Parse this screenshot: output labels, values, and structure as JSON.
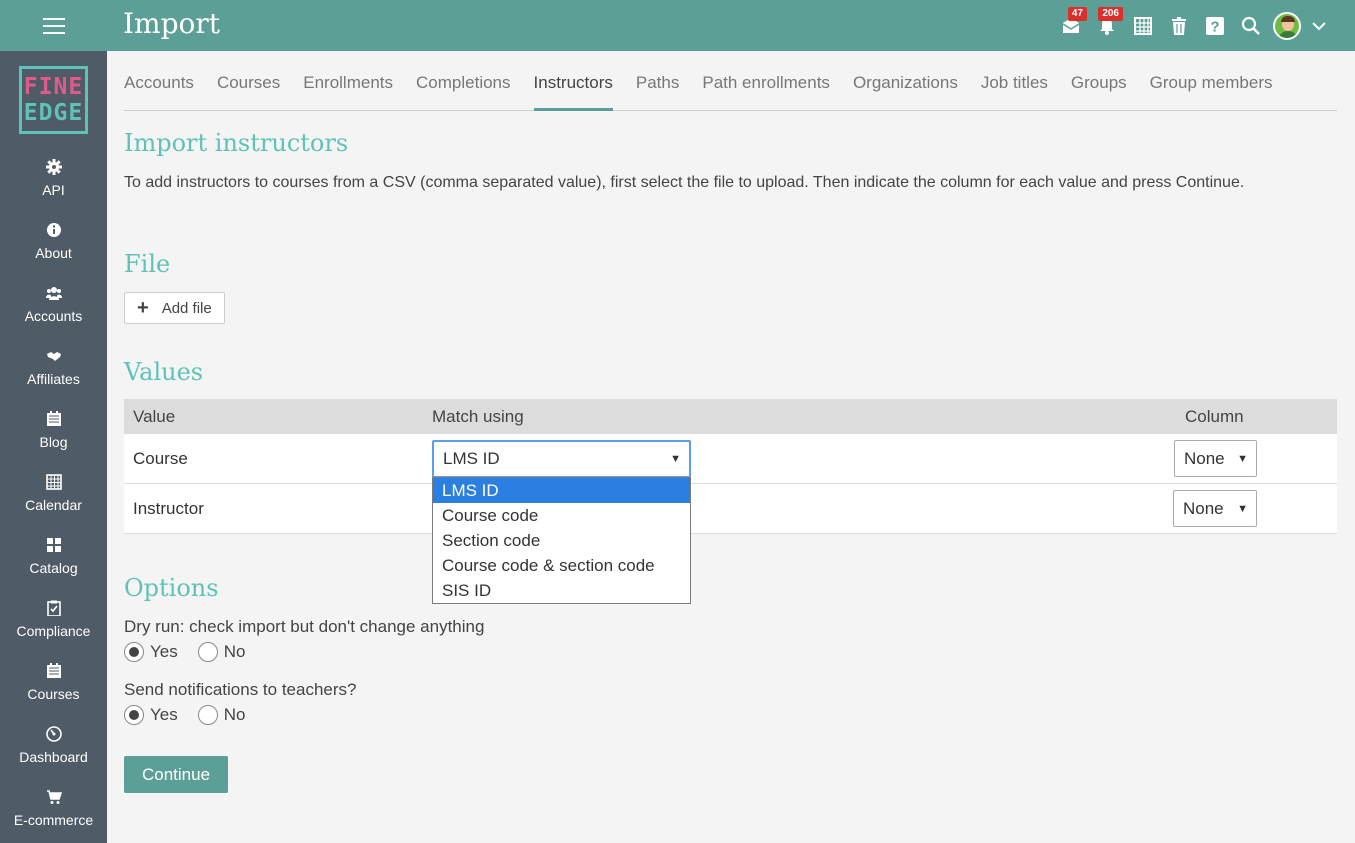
{
  "header": {
    "title": "Import",
    "messages_badge": "47",
    "notifications_badge": "206"
  },
  "sidebar": {
    "logo_line1": "FINE",
    "logo_line2": "EDGE",
    "items": [
      {
        "label": "API",
        "icon": "gear-icon"
      },
      {
        "label": "About",
        "icon": "info-icon"
      },
      {
        "label": "Accounts",
        "icon": "users-icon"
      },
      {
        "label": "Affiliates",
        "icon": "handshake-icon"
      },
      {
        "label": "Blog",
        "icon": "blog-icon"
      },
      {
        "label": "Calendar",
        "icon": "calendar-icon"
      },
      {
        "label": "Catalog",
        "icon": "catalog-icon"
      },
      {
        "label": "Compliance",
        "icon": "clipboard-check-icon"
      },
      {
        "label": "Courses",
        "icon": "courses-icon"
      },
      {
        "label": "Dashboard",
        "icon": "dashboard-icon"
      },
      {
        "label": "E-commerce",
        "icon": "cart-icon"
      }
    ]
  },
  "tabs": [
    "Accounts",
    "Courses",
    "Enrollments",
    "Completions",
    "Instructors",
    "Paths",
    "Path enrollments",
    "Organizations",
    "Job titles",
    "Groups",
    "Group members"
  ],
  "active_tab": "Instructors",
  "main": {
    "heading": "Import instructors",
    "description": "To add instructors to courses from a CSV (comma separated value), first select the file to upload. Then indicate the column for each value and press Continue.",
    "file_heading": "File",
    "add_file_label": "Add file",
    "values_heading": "Values",
    "table": {
      "headers": [
        "Value",
        "Match using",
        "Column"
      ],
      "rows": [
        {
          "value": "Course",
          "match": "LMS ID",
          "column": "None"
        },
        {
          "value": "Instructor",
          "match": "",
          "column": "None"
        }
      ]
    },
    "dropdown_options": [
      "LMS ID",
      "Course code",
      "Section code",
      "Course code & section code",
      "SIS ID"
    ],
    "dropdown_selected": "LMS ID",
    "options_heading": "Options",
    "dry_run_label": "Dry run: check import but don't change anything",
    "dry_run_value": "Yes",
    "notify_label": "Send notifications to teachers?",
    "notify_value": "Yes",
    "yes_label": "Yes",
    "no_label": "No",
    "continue_label": "Continue"
  },
  "colors": {
    "topbar": "#5b9f97",
    "sidebar": "#4f5b66",
    "accent": "#5ec2b7",
    "badge": "#d9302c",
    "selected_option": "#2a7fe0"
  }
}
